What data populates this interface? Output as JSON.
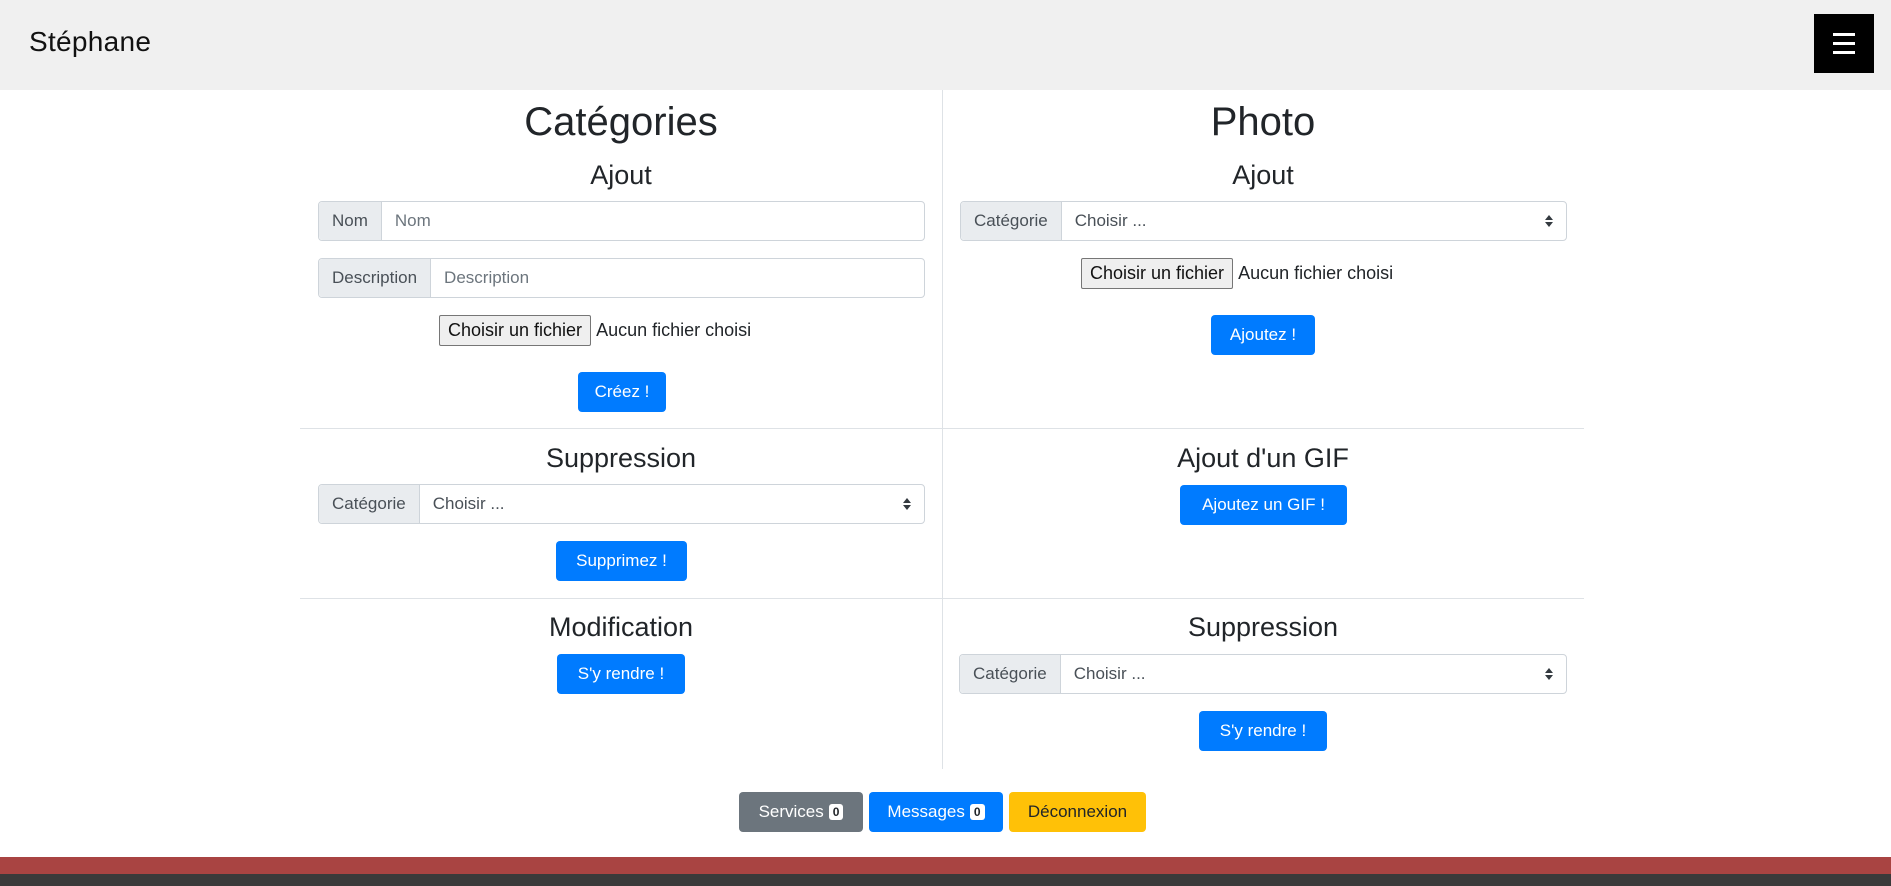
{
  "header": {
    "brand": "Stéphane",
    "menu_icon": "hamburger-menu-icon"
  },
  "categories": {
    "title": "Catégories",
    "add": {
      "title": "Ajout",
      "name_addon": "Nom",
      "name_placeholder": "Nom",
      "desc_addon": "Description",
      "desc_placeholder": "Description",
      "file_button": "Choisir un fichier",
      "file_status": "Aucun fichier choisi",
      "submit": "Créez !"
    },
    "delete": {
      "title": "Suppression",
      "addon": "Catégorie",
      "select_value": "Choisir ...",
      "submit": "Supprimez !"
    },
    "modify": {
      "title": "Modification",
      "submit": "S'y rendre !"
    }
  },
  "photo": {
    "title": "Photo",
    "add": {
      "title": "Ajout",
      "addon": "Catégorie",
      "select_value": "Choisir ...",
      "file_button": "Choisir un fichier",
      "file_status": "Aucun fichier choisi",
      "submit": "Ajoutez !"
    },
    "gif": {
      "title": "Ajout d'un GIF",
      "submit": "Ajoutez un GIF !"
    },
    "delete": {
      "title": "Suppression",
      "addon": "Catégorie",
      "select_value": "Choisir ...",
      "submit": "S'y rendre !"
    }
  },
  "footer_buttons": {
    "services_label": "Services",
    "services_count": "0",
    "messages_label": "Messages",
    "messages_count": "0",
    "logout_label": "Déconnexion"
  },
  "colors": {
    "primary": "#007bff",
    "secondary": "#6c757d",
    "warning": "#ffc107",
    "footer_red": "#a94442",
    "footer_dark": "#3a3a3a"
  }
}
